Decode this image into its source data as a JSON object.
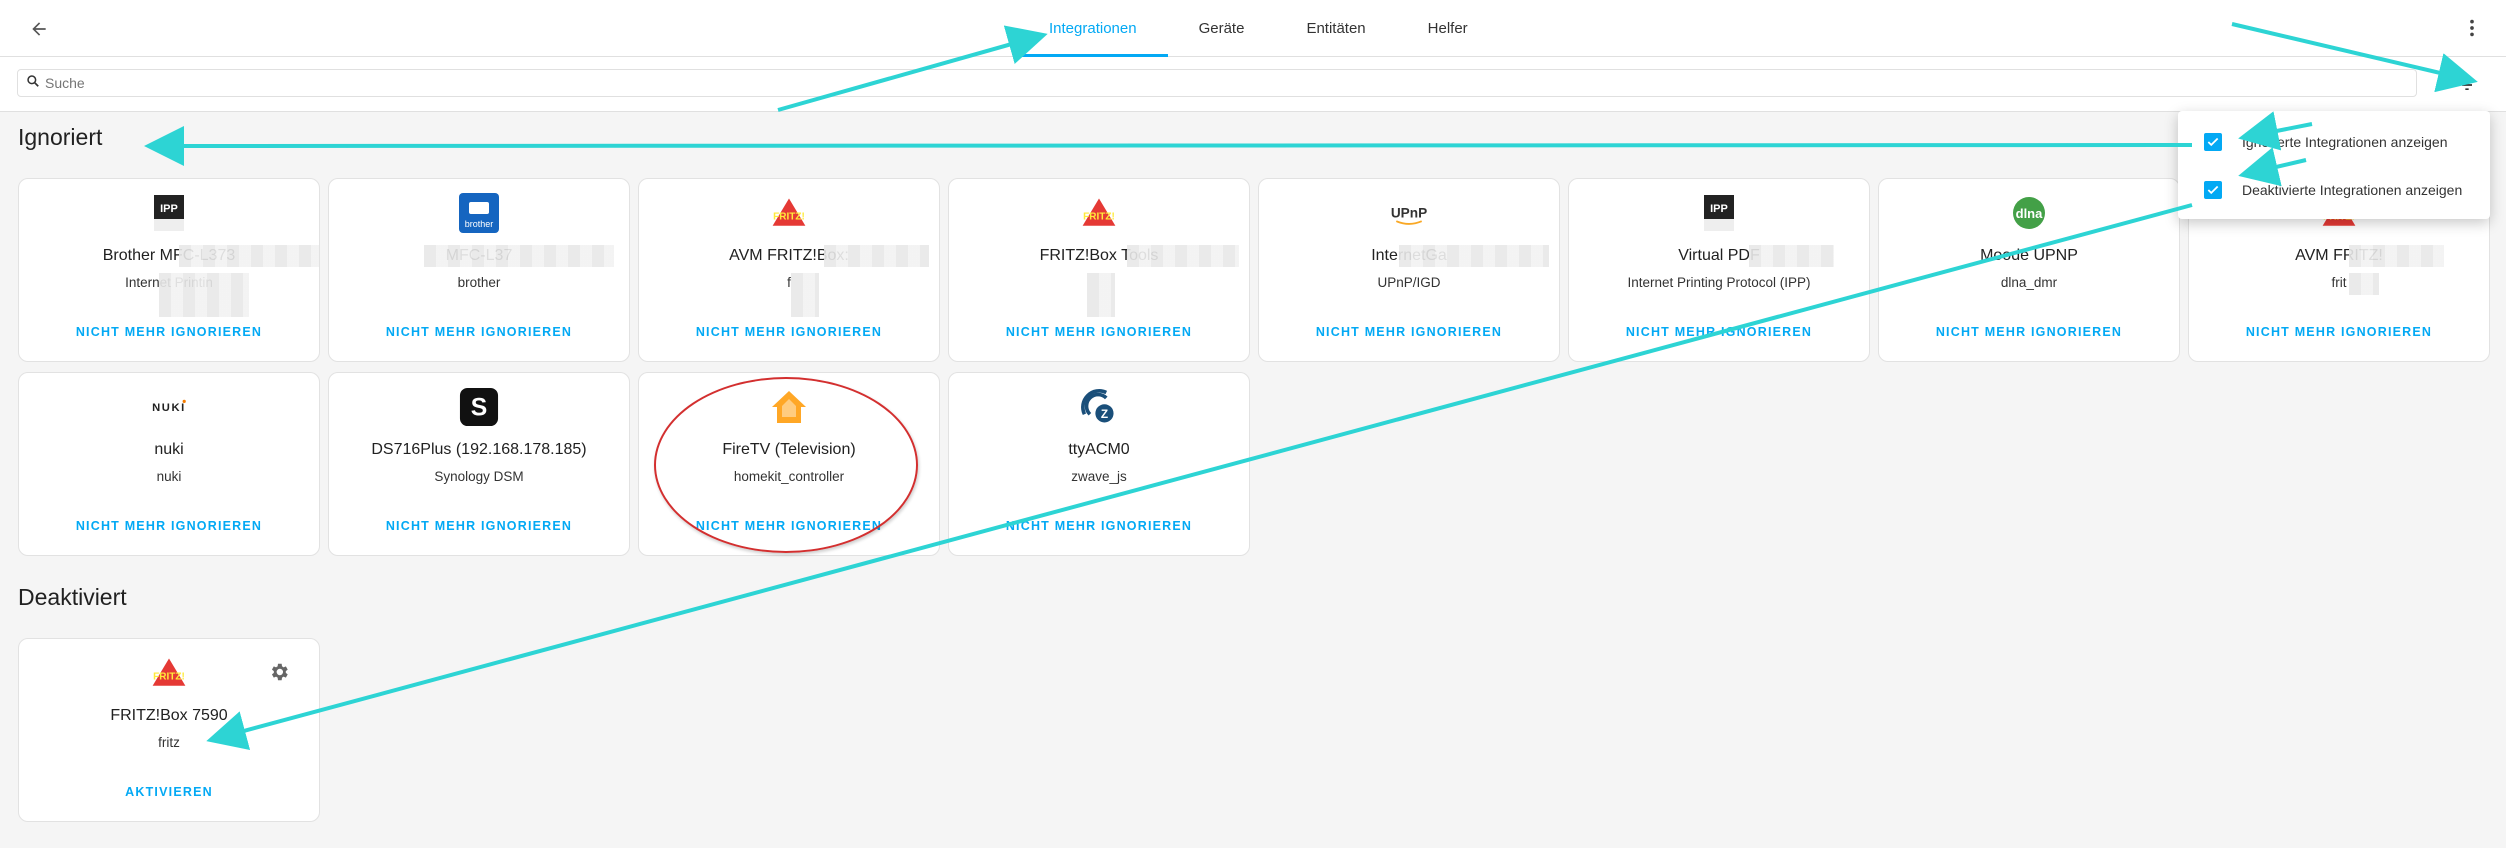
{
  "header": {
    "tabs": [
      {
        "label": "Integrationen",
        "active": true
      },
      {
        "label": "Geräte",
        "active": false
      },
      {
        "label": "Entitäten",
        "active": false
      },
      {
        "label": "Helfer",
        "active": false
      }
    ]
  },
  "search": {
    "placeholder": "Suche"
  },
  "filter_menu": {
    "items": [
      {
        "label": "Ignorierte Integrationen anzeigen",
        "checked": true
      },
      {
        "label": "Deaktivierte Integrationen anzeigen",
        "checked": true
      }
    ]
  },
  "sections": {
    "ignored_title": "Ignoriert",
    "disabled_title": "Deaktiviert"
  },
  "ignored_cards": [
    {
      "title": "Brother MFC-L373",
      "domain": "Internet Printin",
      "action": "NICHT MEHR IGNORIEREN",
      "icon": "ipp-icon"
    },
    {
      "title": "MFC-L37",
      "domain": "brother",
      "action": "NICHT MEHR IGNORIEREN",
      "icon": "brother-icon"
    },
    {
      "title": "AVM FRITZ!Box:",
      "domain": "f",
      "action": "NICHT MEHR IGNORIEREN",
      "icon": "fritz-icon"
    },
    {
      "title": "FRITZ!Box Tools",
      "domain": "",
      "action": "NICHT MEHR IGNORIEREN",
      "icon": "fritz-icon"
    },
    {
      "title": "InternetGa",
      "domain": "UPnP/IGD",
      "action": "NICHT MEHR IGNORIEREN",
      "icon": "upnp-icon"
    },
    {
      "title": "Virtual PDF",
      "domain": "Internet Printing Protocol (IPP)",
      "action": "NICHT MEHR IGNORIEREN",
      "icon": "ipp-icon"
    },
    {
      "title": "Moode UPNP",
      "domain": "dlna_dmr",
      "action": "NICHT MEHR IGNORIEREN",
      "icon": "dlna-icon"
    },
    {
      "title": "AVM FRITZ!",
      "domain": "frit",
      "action": "NICHT MEHR IGNORIEREN",
      "icon": "fritz-icon"
    },
    {
      "title": "nuki",
      "domain": "nuki",
      "action": "NICHT MEHR IGNORIEREN",
      "icon": "nuki-icon"
    },
    {
      "title": "DS716Plus (192.168.178.185)",
      "domain": "Synology DSM",
      "action": "NICHT MEHR IGNORIEREN",
      "icon": "synology-icon"
    },
    {
      "title": "FireTV (Television)",
      "domain": "homekit_controller",
      "action": "NICHT MEHR IGNORIEREN",
      "icon": "homekit-icon"
    },
    {
      "title": "ttyACM0",
      "domain": "zwave_js",
      "action": "NICHT MEHR IGNORIEREN",
      "icon": "zwave-icon"
    }
  ],
  "disabled_cards": [
    {
      "title": "FRITZ!Box 7590",
      "domain": "fritz",
      "action": "AKTIVIEREN",
      "icon": "fritz-icon"
    }
  ],
  "colors": {
    "accent": "#03a9f4",
    "annotation_arrow": "#2dd4d4",
    "highlight_oval": "#d32f2f"
  }
}
